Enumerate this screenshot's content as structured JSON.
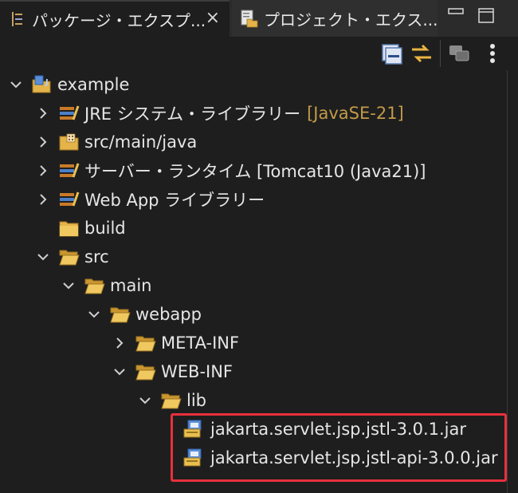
{
  "tabs": [
    {
      "label": "パッケージ・エクスプ...",
      "active": true,
      "close": "×"
    },
    {
      "label": "プロジェクト・エクス...",
      "active": false
    }
  ],
  "tree": [
    {
      "id": "example",
      "label": "example",
      "expanded": true,
      "icon": "project-icon"
    },
    {
      "id": "jre",
      "label": "JRE システム・ライブラリー",
      "decoration": "[JavaSE-21]",
      "expanded": false,
      "icon": "library-icon"
    },
    {
      "id": "src-main-java",
      "label": "src/main/java",
      "expanded": false,
      "icon": "source-folder-icon"
    },
    {
      "id": "server-runtime",
      "label": "サーバー・ランタイム [Tomcat10 (Java21)]",
      "expanded": false,
      "icon": "library-icon"
    },
    {
      "id": "webapp-lib",
      "label": "Web App ライブラリー",
      "expanded": false,
      "icon": "library-icon"
    },
    {
      "id": "build",
      "label": "build",
      "expanded": null,
      "icon": "folder-icon"
    },
    {
      "id": "src",
      "label": "src",
      "expanded": true,
      "icon": "folder-icon"
    },
    {
      "id": "main",
      "label": "main",
      "expanded": true,
      "icon": "folder-icon"
    },
    {
      "id": "webapp",
      "label": "webapp",
      "expanded": true,
      "icon": "folder-icon"
    },
    {
      "id": "meta-inf",
      "label": "META-INF",
      "expanded": false,
      "icon": "folder-icon"
    },
    {
      "id": "web-inf",
      "label": "WEB-INF",
      "expanded": true,
      "icon": "folder-icon"
    },
    {
      "id": "lib",
      "label": "lib",
      "expanded": true,
      "icon": "folder-icon"
    },
    {
      "id": "jar1",
      "label": "jakarta.servlet.jsp.jstl-3.0.1.jar",
      "expanded": null,
      "icon": "jar-icon"
    },
    {
      "id": "jar2",
      "label": "jakarta.servlet.jsp.jstl-api-3.0.0.jar",
      "expanded": null,
      "icon": "jar-icon"
    }
  ],
  "colors": {
    "decoration": "#c19b48",
    "highlight": "#e8303c",
    "background": "#1e1e1e"
  }
}
